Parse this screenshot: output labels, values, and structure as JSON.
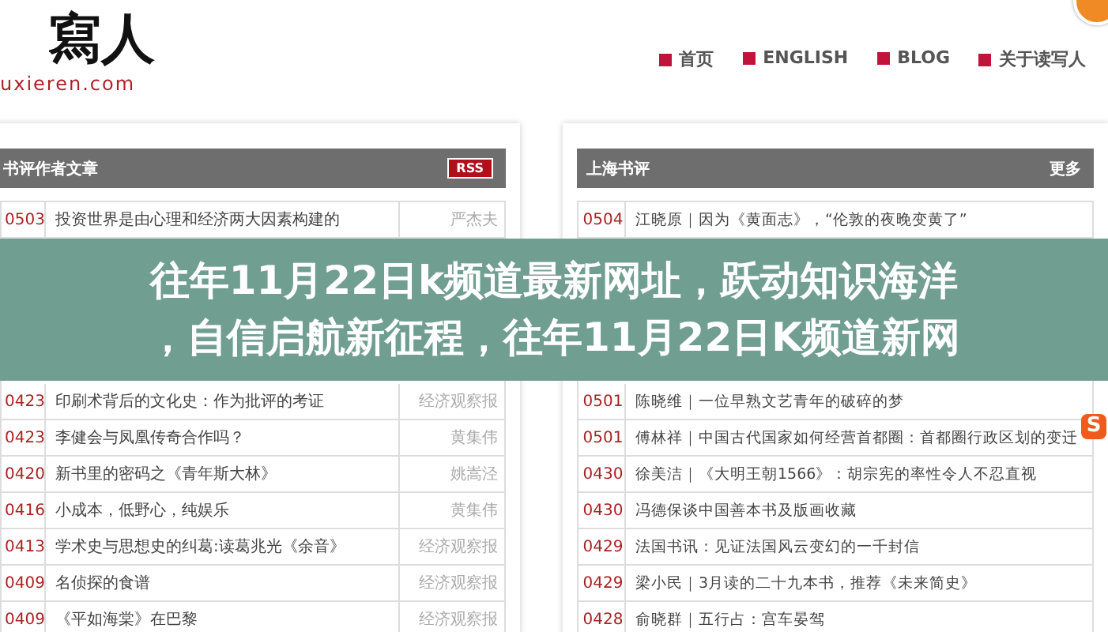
{
  "logo": {
    "mark": "寫人",
    "domain": "uxieren.com"
  },
  "nav": [
    "首页",
    "ENGLISH",
    "BLOG",
    "关于读写人"
  ],
  "corner_badge": "S",
  "left_panel": {
    "title": "书评作者文章",
    "rss": "RSS",
    "rows_top": [
      {
        "date": "0503",
        "title": "投资世界是由心理和经济两大因素构建的",
        "author": "严杰夫"
      }
    ],
    "rows_bottom": [
      {
        "date": "0423",
        "title": "印刷术背后的文化史：作为批评的考证",
        "author": "经济观察报"
      },
      {
        "date": "0423",
        "title": "李健会与凤凰传奇合作吗？",
        "author": "黄集伟"
      },
      {
        "date": "0420",
        "title": "新书里的密码之《青年斯大林》",
        "author": "姚嵩泾"
      },
      {
        "date": "0416",
        "title": "小成本，低野心，纯娱乐",
        "author": "黄集伟"
      },
      {
        "date": "0413",
        "title": "学术史与思想史的纠葛:读葛兆光《余音》",
        "author": "经济观察报"
      },
      {
        "date": "0409",
        "title": "名侦探的食谱",
        "author": "经济观察报"
      },
      {
        "date": "0409",
        "title": "《平如海棠》在巴黎",
        "author": "经济观察报"
      }
    ]
  },
  "right_panel": {
    "title": "上海书评",
    "more": "更多",
    "rows_top": [
      {
        "date": "0504",
        "title": "江晓原｜因为《黄面志》，“伦敦的夜晚变黄了”"
      }
    ],
    "rows_bottom": [
      {
        "date": "0501",
        "title": "陈晓维｜一位早熟文艺青年的破碎的梦"
      },
      {
        "date": "0501",
        "title": "傅林祥｜中国古代国家如何经营首都圈：首都圈行政区划的变迁"
      },
      {
        "date": "0430",
        "title": "徐美洁｜《大明王朝1566》：胡宗宪的率性令人不忍直视"
      },
      {
        "date": "0430",
        "title": "冯德保谈中国善本书及版画收藏"
      },
      {
        "date": "0429",
        "title": "法国书讯：见证法国风云变幻的一千封信"
      },
      {
        "date": "0429",
        "title": "梁小民｜3月读的二十九本书，推荐《未来简史》"
      },
      {
        "date": "0428",
        "title": "俞晓群｜五行占：宫车晏驾"
      }
    ]
  },
  "caption": [
    "往年11月22日k频道最新网址，跃动知识海洋",
    "，自信启航新征程，往年11月22日K频道新网"
  ]
}
